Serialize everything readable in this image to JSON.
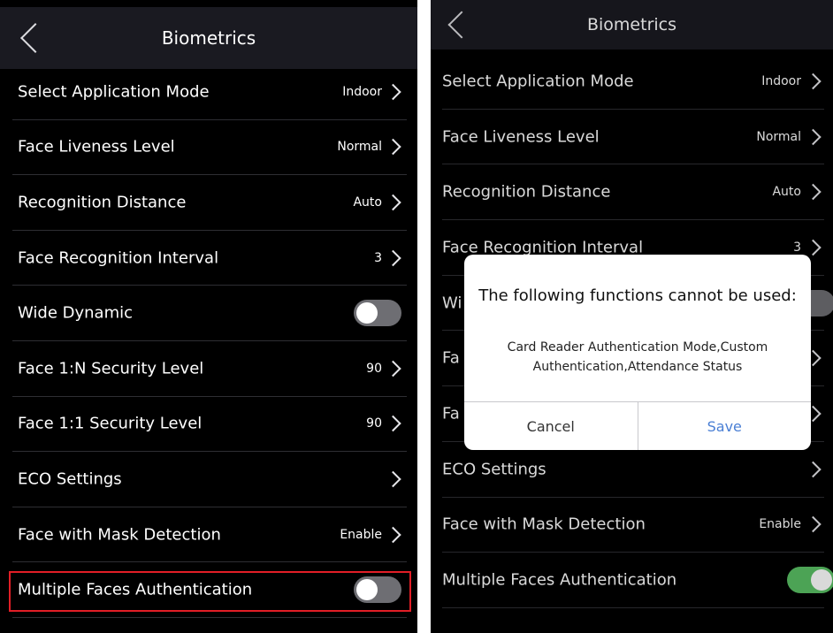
{
  "left": {
    "header": {
      "title": "Biometrics"
    },
    "rows": [
      {
        "label": "Select Application Mode",
        "value": "Indoor",
        "control": "chevron"
      },
      {
        "label": "Face Liveness Level",
        "value": "Normal",
        "control": "chevron"
      },
      {
        "label": "Recognition Distance",
        "value": "Auto",
        "control": "chevron"
      },
      {
        "label": "Face Recognition Interval",
        "value": "3",
        "control": "chevron"
      },
      {
        "label": "Wide Dynamic",
        "value": "",
        "control": "toggle-off"
      },
      {
        "label": "Face 1:N Security Level",
        "value": "90",
        "control": "chevron"
      },
      {
        "label": "Face 1:1 Security Level",
        "value": "90",
        "control": "chevron"
      },
      {
        "label": "ECO Settings",
        "value": "",
        "control": "chevron"
      },
      {
        "label": "Face with Mask Detection",
        "value": "Enable",
        "control": "chevron"
      },
      {
        "label": "Multiple Faces Authentication",
        "value": "",
        "control": "toggle-off"
      }
    ]
  },
  "right": {
    "header": {
      "title": "Biometrics"
    },
    "rows": [
      {
        "label": "Select Application Mode",
        "value": "Indoor",
        "control": "chevron"
      },
      {
        "label": "Face Liveness Level",
        "value": "Normal",
        "control": "chevron"
      },
      {
        "label": "Recognition Distance",
        "value": "Auto",
        "control": "chevron"
      },
      {
        "label": "Face Recognition Interval",
        "value": "3",
        "control": "chevron"
      },
      {
        "label": "Wi",
        "value": "",
        "control": "toggle-off"
      },
      {
        "label": "Fa",
        "value": "",
        "control": "chevron"
      },
      {
        "label": "Fa",
        "value": "",
        "control": "chevron"
      },
      {
        "label": "ECO Settings",
        "value": "",
        "control": "chevron"
      },
      {
        "label": "Face with Mask Detection",
        "value": "Enable",
        "control": "chevron"
      },
      {
        "label": "Multiple Faces Authentication",
        "value": "",
        "control": "toggle-on"
      }
    ],
    "dialog": {
      "title": "The following functions cannot be used:",
      "message": "Card Reader Authentication Mode,Custom Authentication,Attendance Status",
      "cancel_label": "Cancel",
      "save_label": "Save"
    }
  },
  "colors": {
    "background": "#000000",
    "header": "#1a1a21",
    "toggle_on": "#5ac064",
    "toggle_off": "#6e6e73",
    "highlight": "#e21e26",
    "save_text": "#4a7fd4"
  },
  "icons": {
    "back": "chevron-left-icon",
    "row_arrow": "chevron-right-icon"
  }
}
